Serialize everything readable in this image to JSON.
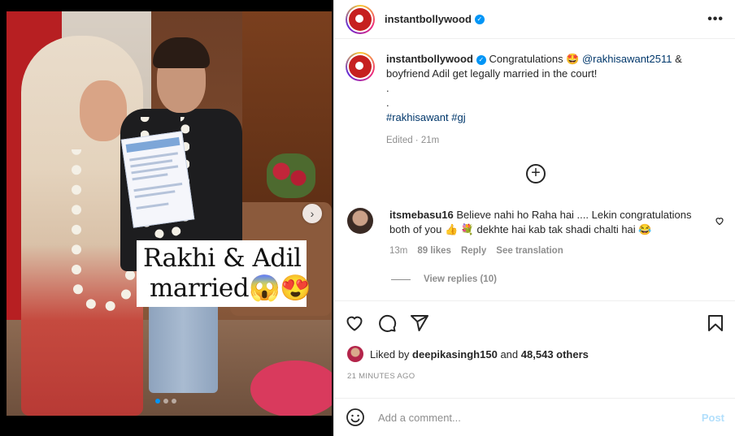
{
  "media": {
    "overlay_line1": "Rakhi & Adil",
    "overlay_line2": "married😱😍",
    "next_glyph": "›",
    "carousel_index": 1,
    "carousel_count": 3
  },
  "post": {
    "author": "instantbollywood",
    "verified": true,
    "more_glyph": "•••",
    "caption_part1": "Congratulations 🤩 ",
    "caption_mention": "@rakhisawant2511",
    "caption_part2": " & boyfriend Adil get legally married in the court!",
    "caption_dot1": ".",
    "caption_dot2": ".",
    "hashtag1": "#rakhisawant",
    "hashtag2": "#gj",
    "edited_meta": "Edited · 21m",
    "load_more_glyph": "+"
  },
  "comment": {
    "author": "itsmebasu16",
    "text": "Believe nahi ho Raha hai .... Lekin congratulations both of you 👍 💐 dekhte hai kab tak shadi chalti hai 😂",
    "time": "13m",
    "likes": "89 likes",
    "reply": "Reply",
    "translation": "See translation",
    "view_replies": "View replies (10)"
  },
  "likes": {
    "prefix": "Liked by ",
    "liker": "deepikasingh150",
    "middle": " and ",
    "others": "48,543 others"
  },
  "timestamp": "21 MINUTES AGO",
  "add_comment": {
    "placeholder": "Add a comment...",
    "post_label": "Post"
  },
  "colors": {
    "accent": "#0095f6",
    "link": "#00376b",
    "post_disabled": "#b2dffc"
  },
  "icons": {
    "like": "heart-icon",
    "comment": "comment-bubble-icon",
    "share": "paper-plane-icon",
    "save": "bookmark-icon",
    "emoji": "emoji-icon"
  }
}
